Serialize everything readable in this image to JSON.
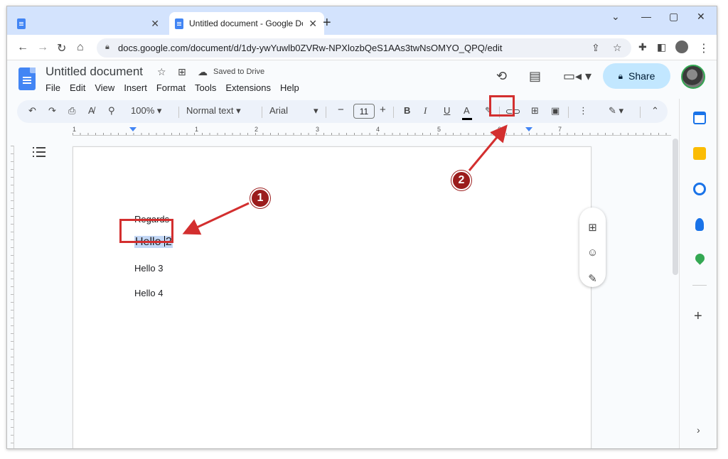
{
  "browser": {
    "tabs": [
      {
        "title": "",
        "favicon": "docs-icon"
      },
      {
        "title": "Untitled document - Google Doc",
        "favicon": "docs-icon"
      }
    ],
    "new_tab": "+",
    "url": "docs.google.com/document/d/1dy-ywYuwlb0ZVRw-NPXlozbQeS1AAs3twNsOMYO_QPQ/edit"
  },
  "docs": {
    "title": "Untitled document",
    "save_status": "Saved to Drive",
    "menu": [
      "File",
      "Edit",
      "View",
      "Insert",
      "Format",
      "Tools",
      "Extensions",
      "Help"
    ],
    "share_label": "Share"
  },
  "toolbar": {
    "zoom": "100%",
    "style": "Normal text",
    "font": "Arial",
    "font_size": "11",
    "minus": "−",
    "plus": "+",
    "bold": "B",
    "italic": "I",
    "underline": "U",
    "text_color": "A"
  },
  "ruler": {
    "numbers": [
      "1",
      "1",
      "2",
      "3",
      "4",
      "5",
      "6",
      "7"
    ]
  },
  "document": {
    "lines": [
      "Regards",
      "Hello 2",
      "Hello 3",
      "Hello 4"
    ],
    "line2_prefix": "Hello ",
    "line2_suffix": "2"
  },
  "annotations": {
    "badge1": "1",
    "badge2": "2"
  },
  "colors": {
    "accent": "#4285f4",
    "share_bg": "#c2e7ff",
    "annotation_red": "#d32f2f",
    "selection": "#c3d7f5"
  }
}
